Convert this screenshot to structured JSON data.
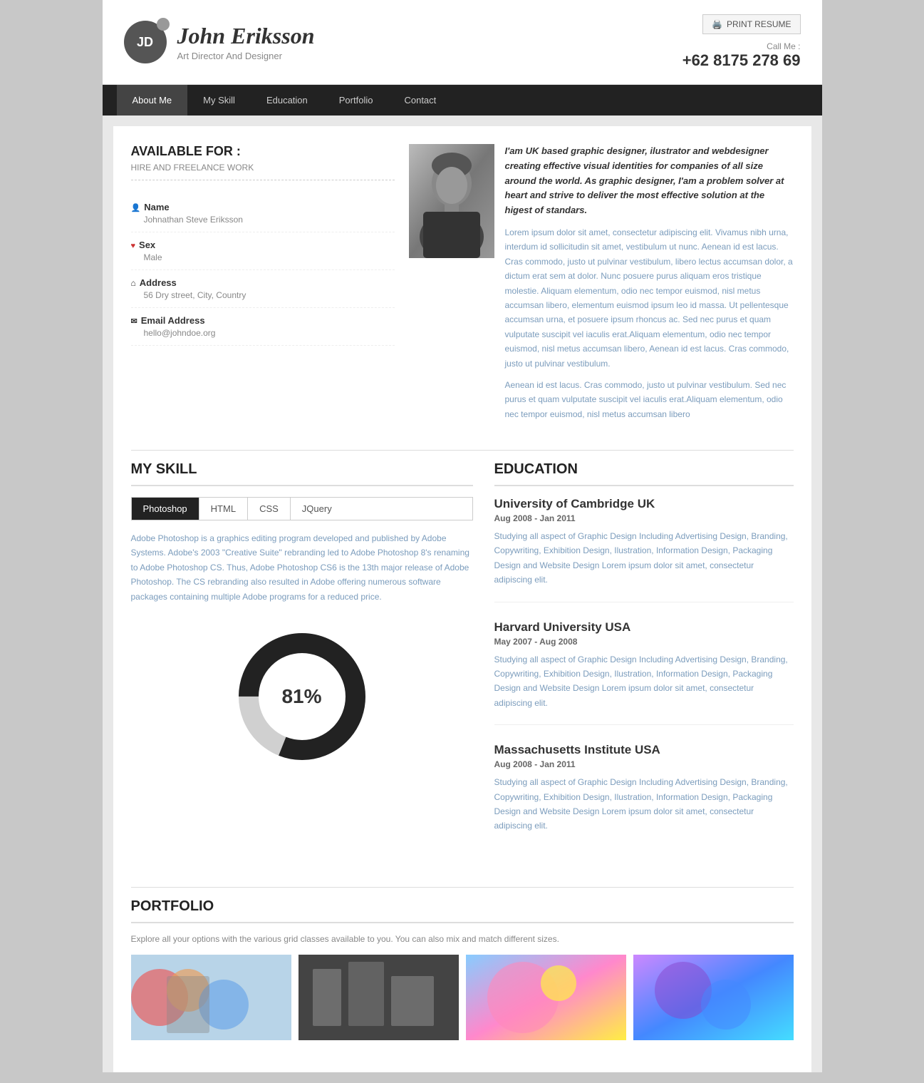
{
  "header": {
    "initials": "JD",
    "name": "John Eriksson",
    "title": "Art Director And Designer",
    "print_button": "PRINT RESUME",
    "call_label": "Call Me :",
    "phone": "+62 8175 278 69"
  },
  "nav": {
    "items": [
      {
        "label": "About Me",
        "active": true
      },
      {
        "label": "My Skill",
        "active": false
      },
      {
        "label": "Education",
        "active": false
      },
      {
        "label": "Portfolio",
        "active": false
      },
      {
        "label": "Contact",
        "active": false
      }
    ]
  },
  "available": {
    "title": "AVAILABLE FOR :",
    "subtitle": "HIRE AND FREELANCE WORK"
  },
  "personal_info": {
    "name_label": "Name",
    "name_value": "Johnathan Steve Eriksson",
    "sex_label": "Sex",
    "sex_value": "Male",
    "address_label": "Address",
    "address_value": "56 Dry street, City, Country",
    "email_label": "Email Address",
    "email_value": "hello@johndoe.org"
  },
  "bio": {
    "intro": "I'am UK based graphic designer, ilustrator and webdesigner creating effective visual identities for companies of all size around the world. As graphic designer, I'am a problem solver at heart and strive to deliver the most effective solution at the higest of standars.",
    "lorem1": "Lorem ipsum dolor sit amet, consectetur adipiscing elit. Vivamus nibh urna, interdum id sollicitudin sit amet, vestibulum ut nunc. Aenean id est lacus. Cras commodo, justo ut pulvinar vestibulum, libero lectus accumsan dolor, a dictum erat sem at dolor. Nunc posuere purus aliquam eros tristique molestie. Aliquam elementum, odio nec tempor euismod, nisl metus accumsan libero, elementum euismod ipsum leo id massa. Ut pellentesque accumsan urna, et posuere ipsum rhoncus ac. Sed nec purus et quam vulputate suscipit vel iaculis erat.Aliquam elementum, odio nec tempor euismod, nisl metus accumsan libero, Aenean id est lacus. Cras commodo, justo ut pulvinar vestibulum.",
    "lorem2": "Aenean id est lacus. Cras commodo, justo ut pulvinar vestibulum. Sed nec purus et quam vulputate suscipit vel iaculis erat.Aliquam elementum, odio nec tempor euismod, nisl metus accumsan libero"
  },
  "skills": {
    "section_title": "MY SKILL",
    "tabs": [
      {
        "label": "Photoshop",
        "active": true
      },
      {
        "label": "HTML",
        "active": false
      },
      {
        "label": "CSS",
        "active": false
      },
      {
        "label": "JQuery",
        "active": false
      }
    ],
    "description": "Adobe Photoshop is a graphics editing program developed and published by Adobe Systems. Adobe's 2003 \"Creative Suite\" rebranding led to Adobe Photoshop 8's renaming to Adobe Photoshop CS. Thus, Adobe Photoshop CS6 is the 13th major release of Adobe Photoshop. The CS rebranding also resulted in Adobe offering numerous software packages containing multiple Adobe programs for a reduced price.",
    "percent": "81%",
    "percent_value": 81
  },
  "education": {
    "section_title": "EDUCATION",
    "items": [
      {
        "university": "University of Cambridge UK",
        "date": "Aug 2008 - Jan 2011",
        "description": "Studying all aspect of Graphic Design Including Advertising Design, Branding, Copywriting, Exhibition Design, Ilustration, Information Design, Packaging Design and Website Design Lorem ipsum dolor sit amet, consectetur adipiscing elit."
      },
      {
        "university": "Harvard University USA",
        "date": "May 2007 - Aug 2008",
        "description": "Studying all aspect of Graphic Design Including Advertising Design, Branding, Copywriting, Exhibition Design, Ilustration, Information Design, Packaging Design and Website Design Lorem ipsum dolor sit amet, consectetur adipiscing elit."
      },
      {
        "university": "Massachusetts Institute USA",
        "date": "Aug 2008 - Jan 2011",
        "description": "Studying all aspect of Graphic Design Including Advertising Design, Branding, Copywriting, Exhibition Design, Ilustration, Information Design, Packaging Design and Website Design Lorem ipsum dolor sit amet, consectetur adipiscing elit."
      }
    ]
  },
  "portfolio": {
    "section_title": "PORTFOLIO",
    "subtitle": "Explore all your options with the various grid classes available to you. You can also mix and match different sizes."
  }
}
